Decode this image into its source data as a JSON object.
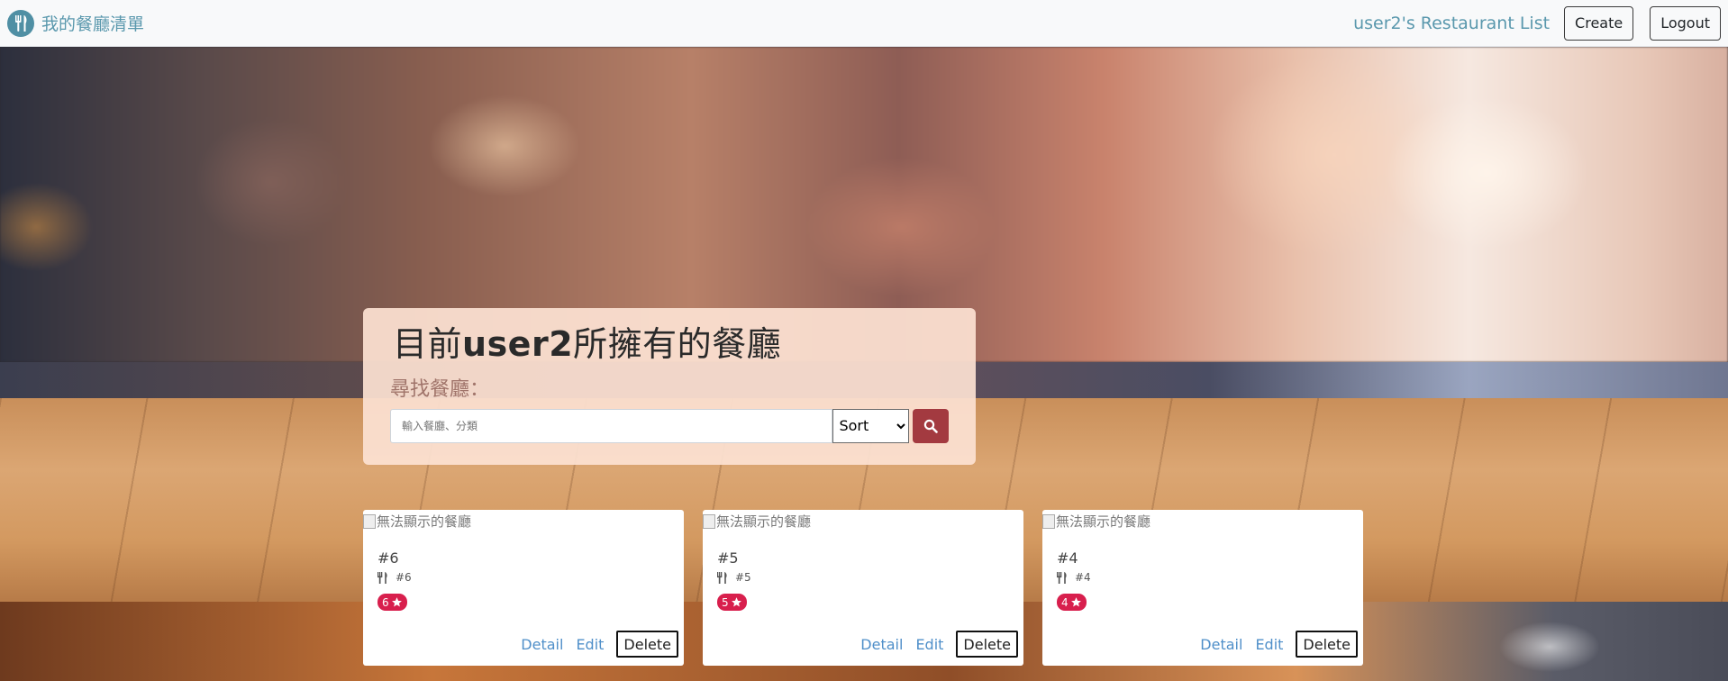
{
  "navbar": {
    "brand": "我的餐廳清單",
    "user_title": "user2's Restaurant List",
    "create_label": "Create",
    "logout_label": "Logout",
    "accent_color": "#5a98ad"
  },
  "search_panel": {
    "title_prefix": "目前",
    "title_user": "user2",
    "title_suffix": "所擁有的餐廳",
    "find_label": "尋找餐廳：",
    "input_placeholder": "輸入餐廳、分類",
    "sort_selected": "Sort",
    "search_icon": "search-icon"
  },
  "cards": [
    {
      "img_alt": "無法顯示的餐廳",
      "name": "#6",
      "category": "#6",
      "rating": "6",
      "detail": "Detail",
      "edit": "Edit",
      "delete": "Delete"
    },
    {
      "img_alt": "無法顯示的餐廳",
      "name": "#5",
      "category": "#5",
      "rating": "5",
      "detail": "Detail",
      "edit": "Edit",
      "delete": "Delete"
    },
    {
      "img_alt": "無法顯示的餐廳",
      "name": "#4",
      "category": "#4",
      "rating": "4",
      "detail": "Detail",
      "edit": "Edit",
      "delete": "Delete"
    }
  ],
  "colors": {
    "search_button": "#a33a40",
    "rating_badge": "#d81f4d",
    "link": "#4f8fc9"
  }
}
